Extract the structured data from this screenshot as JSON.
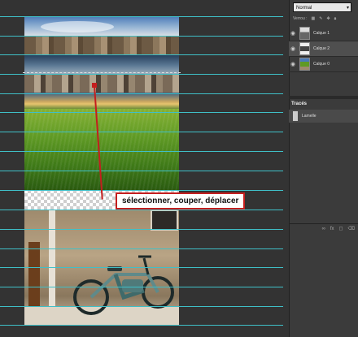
{
  "canvas": {
    "annotation_text": "sélectionner, couper, déplacer",
    "annotation_color": "#c41e1e",
    "guide_color": "#3fc0c8"
  },
  "panel": {
    "blend_mode": "Normal",
    "lock_label": "Verrou :",
    "layers": [
      {
        "name": "Calque 1",
        "visible": true,
        "active": false
      },
      {
        "name": "Calque 2",
        "visible": true,
        "active": true
      },
      {
        "name": "Calque 0",
        "visible": true,
        "active": false
      }
    ],
    "paths_tab": "Tracés",
    "paths": [
      {
        "name": "Lamelle"
      }
    ]
  }
}
